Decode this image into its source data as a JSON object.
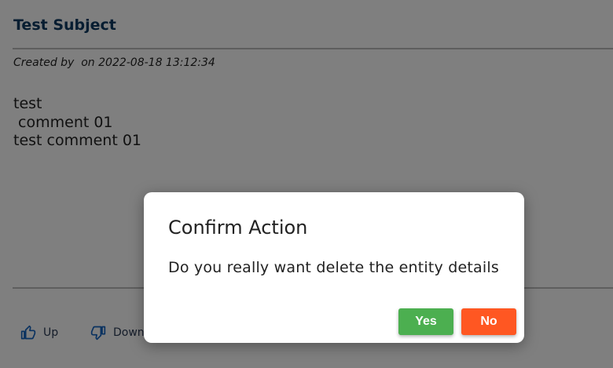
{
  "post": {
    "subject": "Test Subject",
    "meta": "Created by  on 2022-08-18 13:12:34",
    "body": "test\n comment 01\ntest comment 01"
  },
  "votes": {
    "up_label": "Up",
    "down_label": "Down"
  },
  "dialog": {
    "title": "Confirm Action",
    "message": "Do you really want delete the entity details",
    "yes_label": "Yes",
    "no_label": "No"
  },
  "colors": {
    "yes": "#4caf50",
    "no": "#ff5722",
    "subject": "#0e3a63",
    "overlay": "rgba(0,0,0,0.5)"
  }
}
